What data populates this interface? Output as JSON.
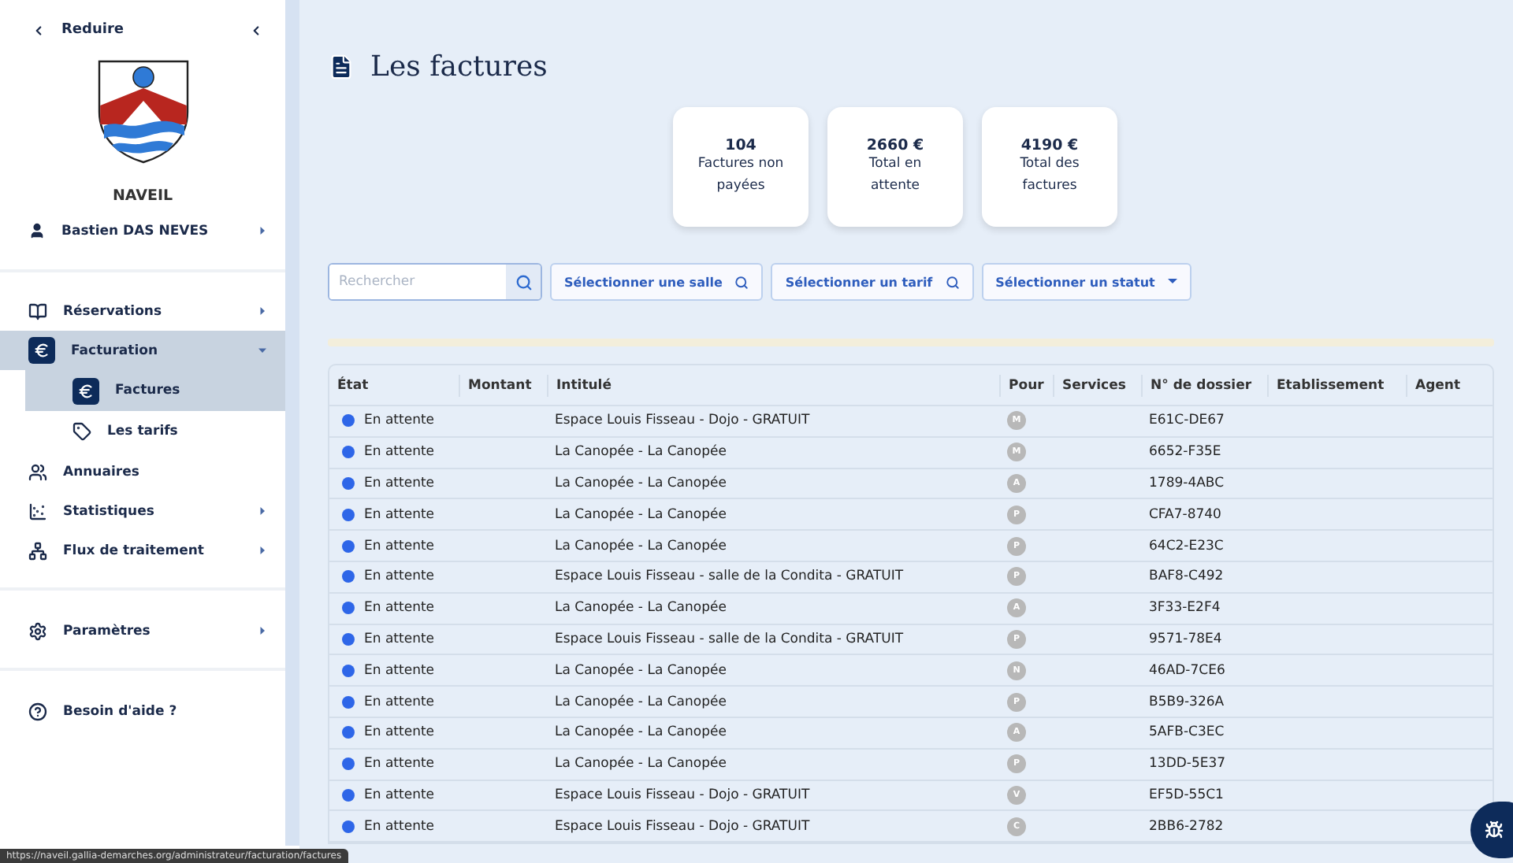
{
  "sidebar": {
    "collapse_label": "Reduire",
    "town": "NAVEIL",
    "user": "Bastien DAS NEVES",
    "sections": [
      {
        "items": [
          {
            "label": "Réservations",
            "kind": "group",
            "expanded": false,
            "selected": false
          },
          {
            "label": "Facturation",
            "kind": "group",
            "expanded": true,
            "selected": true,
            "children": [
              {
                "label": "Factures",
                "selected": true
              },
              {
                "label": "Les tarifs",
                "selected": false
              }
            ]
          },
          {
            "label": "Annuaires",
            "kind": "link",
            "selected": false
          },
          {
            "label": "Statistiques",
            "kind": "group",
            "expanded": false,
            "selected": false
          },
          {
            "label": "Flux de traitement",
            "kind": "group",
            "expanded": false,
            "selected": false
          }
        ]
      },
      {
        "items": [
          {
            "label": "Paramètres",
            "kind": "group",
            "expanded": false,
            "selected": false
          }
        ]
      },
      {
        "items": [
          {
            "label": "Besoin d'aide ?",
            "kind": "link",
            "selected": false
          }
        ]
      }
    ]
  },
  "title": "Les factures",
  "stats": [
    {
      "value": "104",
      "label": "Factures non payées"
    },
    {
      "value": "2660 €",
      "label": "Total en attente"
    },
    {
      "value": "4190 €",
      "label": "Total des factures"
    }
  ],
  "search": {
    "placeholder": "Rechercher"
  },
  "filters": [
    {
      "label": "Sélectionner une salle",
      "kind": "search"
    },
    {
      "label": "Sélectionner un tarif",
      "kind": "search"
    },
    {
      "label": "Sélectionner un statut",
      "kind": "dropdown"
    }
  ],
  "table": {
    "columns": [
      "État",
      "Montant",
      "Intitulé",
      "Pour",
      "Services",
      "N° de dossier",
      "Etablissement",
      "Agent"
    ],
    "rows": [
      {
        "status": "En attente",
        "title": "Espace Louis Fisseau - Dojo - GRATUIT",
        "for": "M",
        "file": "E61C-DE67"
      },
      {
        "status": "En attente",
        "title": "La Canopée - La Canopée",
        "for": "M",
        "file": "6652-F35E"
      },
      {
        "status": "En attente",
        "title": "La Canopée - La Canopée",
        "for": "A",
        "file": "1789-4ABC"
      },
      {
        "status": "En attente",
        "title": "La Canopée - La Canopée",
        "for": "P",
        "file": "CFA7-8740"
      },
      {
        "status": "En attente",
        "title": "La Canopée - La Canopée",
        "for": "P",
        "file": "64C2-E23C"
      },
      {
        "status": "En attente",
        "title": "Espace Louis Fisseau - salle de la Condita - GRATUIT",
        "for": "P",
        "file": "BAF8-C492"
      },
      {
        "status": "En attente",
        "title": "La Canopée - La Canopée",
        "for": "A",
        "file": "3F33-E2F4"
      },
      {
        "status": "En attente",
        "title": "Espace Louis Fisseau - salle de la Condita - GRATUIT",
        "for": "P",
        "file": "9571-78E4"
      },
      {
        "status": "En attente",
        "title": "La Canopée - La Canopée",
        "for": "N",
        "file": "46AD-7CE6"
      },
      {
        "status": "En attente",
        "title": "La Canopée - La Canopée",
        "for": "P",
        "file": "B5B9-326A"
      },
      {
        "status": "En attente",
        "title": "La Canopée - La Canopée",
        "for": "A",
        "file": "5AFB-C3EC"
      },
      {
        "status": "En attente",
        "title": "La Canopée - La Canopée",
        "for": "P",
        "file": "13DD-5E37"
      },
      {
        "status": "En attente",
        "title": "Espace Louis Fisseau - Dojo - GRATUIT",
        "for": "V",
        "file": "EF5D-55C1"
      },
      {
        "status": "En attente",
        "title": "Espace Louis Fisseau - Dojo - GRATUIT",
        "for": "C",
        "file": "2BB6-2782"
      }
    ]
  },
  "status_url": "https://naveil.gallia-demarches.org/administrateur/facturation/factures"
}
